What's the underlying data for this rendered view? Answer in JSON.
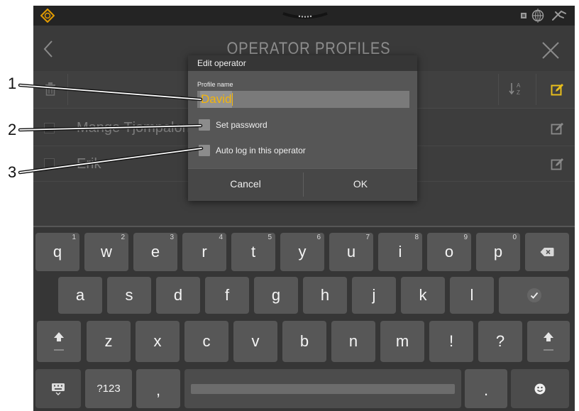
{
  "status_bar": {
    "left_icon": "warning-diamond-icon",
    "center_icon": "pull-down-handle-icon",
    "right_icons": [
      "sd-card-icon",
      "globe-icon",
      "remote-connection-icon"
    ]
  },
  "header": {
    "title": "OPERATOR PROFILES",
    "back_icon": "chevron-left-icon",
    "close_icon": "close-icon"
  },
  "toolbar": {
    "delete_icon": "trash-icon",
    "sort_icon": {
      "top": "A",
      "bottom": "Z"
    },
    "edit_icon": "edit-icon"
  },
  "operators": [
    {
      "name": "Mange Tjompalon"
    },
    {
      "name": "Erik"
    }
  ],
  "dialog": {
    "title": "Edit operator",
    "profile_name": {
      "label": "Profile name",
      "value": "David"
    },
    "set_password": {
      "label": "Set password",
      "checked": false
    },
    "auto_login": {
      "label": "Auto log in this operator",
      "checked": false
    },
    "cancel_label": "Cancel",
    "ok_label": "OK"
  },
  "callouts": [
    "1",
    "2",
    "3"
  ],
  "keyboard": {
    "row1": [
      {
        "key": "q",
        "hint": "1"
      },
      {
        "key": "w",
        "hint": "2"
      },
      {
        "key": "e",
        "hint": "3"
      },
      {
        "key": "r",
        "hint": "4"
      },
      {
        "key": "t",
        "hint": "5"
      },
      {
        "key": "y",
        "hint": "6"
      },
      {
        "key": "u",
        "hint": "7"
      },
      {
        "key": "i",
        "hint": "8"
      },
      {
        "key": "o",
        "hint": "9"
      },
      {
        "key": "p",
        "hint": "0"
      }
    ],
    "row2": [
      "a",
      "s",
      "d",
      "f",
      "g",
      "h",
      "j",
      "k",
      "l"
    ],
    "row3": [
      "z",
      "x",
      "c",
      "v",
      "b",
      "n",
      "m",
      "!",
      "?"
    ],
    "symbols_label": "?123",
    "comma": ",",
    "period": ".",
    "icons": [
      "backspace-icon",
      "enter-check-icon",
      "shift-icon",
      "keyboard-icon",
      "emoji-icon"
    ]
  },
  "colors": {
    "accent": "#f3b50b",
    "warning": "#e39b00",
    "app_background": "#3a3a3a",
    "dialog_body": "#565656",
    "key": "#575757"
  }
}
